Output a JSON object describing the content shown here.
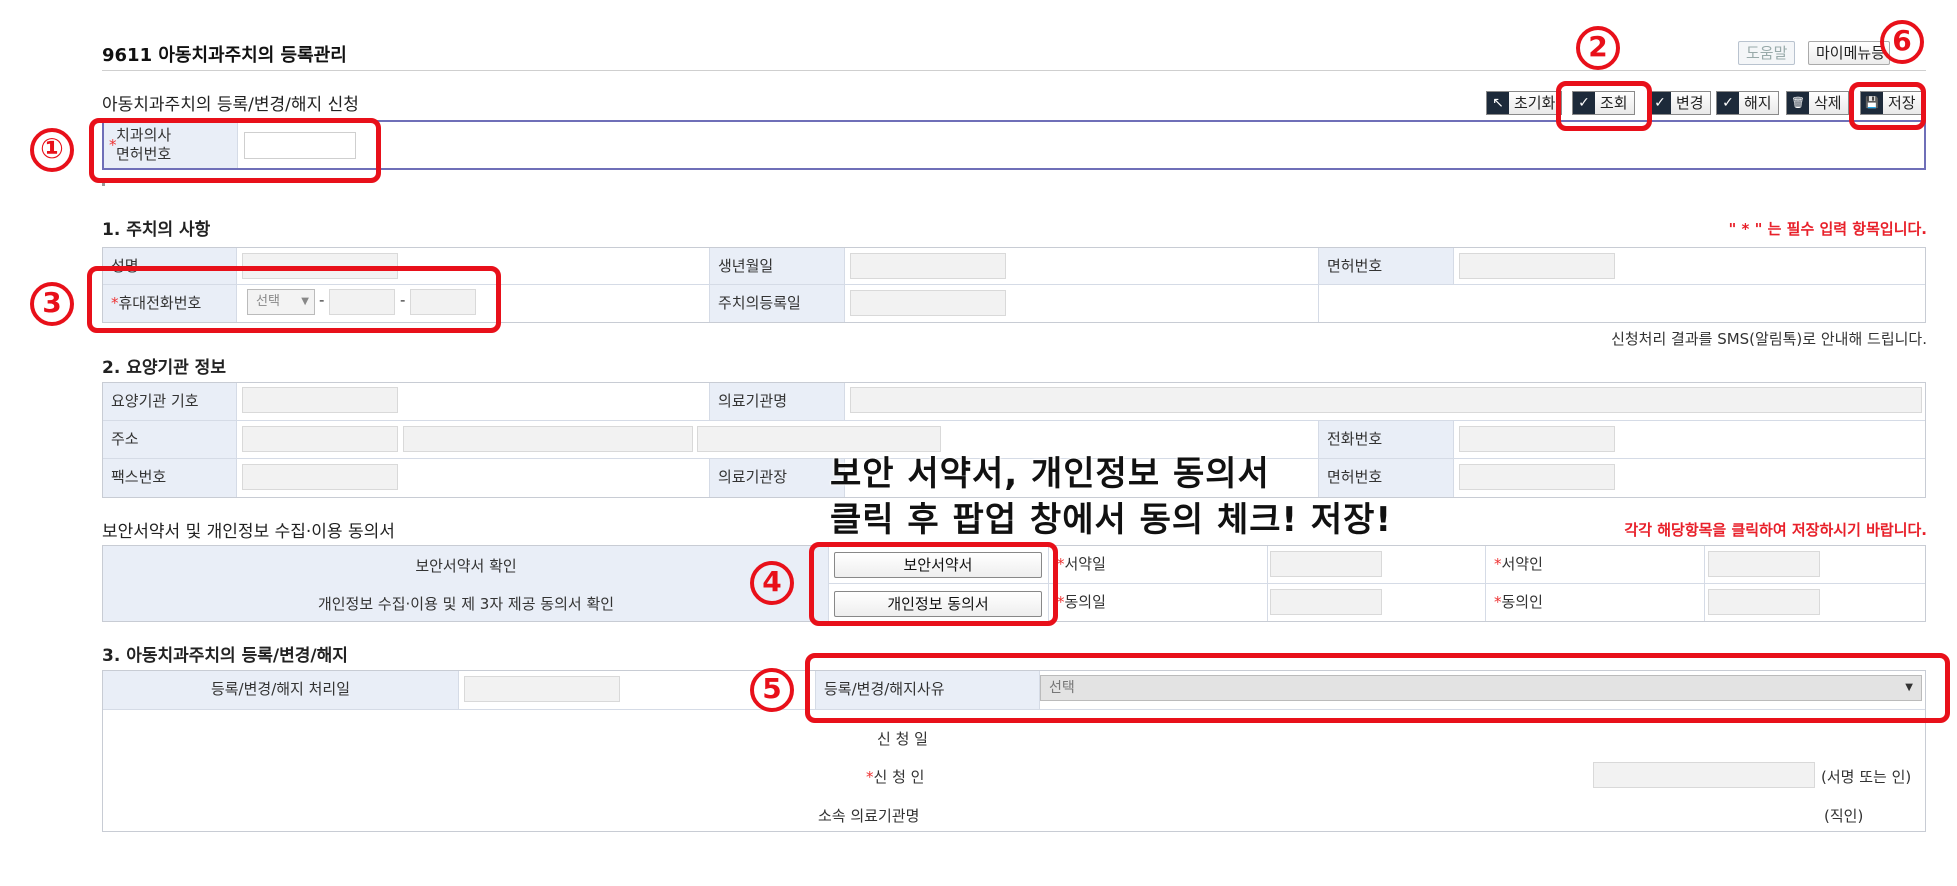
{
  "header": {
    "title": "9611 아동치과주치의 등록관리",
    "help_label": "도움말",
    "mymenu_label": "마이메뉴등",
    "section_title": "아동치과주치의 등록/변경/해지 신청"
  },
  "actions": [
    {
      "label": "초기화",
      "icon": "↖"
    },
    {
      "label": "조회",
      "icon": "✓"
    },
    {
      "label": "변경",
      "icon": "✓"
    },
    {
      "label": "해지",
      "icon": "✓"
    },
    {
      "label": "삭제",
      "icon": "🗑"
    },
    {
      "label": "저장",
      "icon": "💾"
    }
  ],
  "license": {
    "label_line1": "치과의사",
    "label_line2": "면허번호",
    "required": "*"
  },
  "annotations": {
    "n1": "①",
    "n2": "2",
    "n3": "3",
    "n4": "4",
    "n5": "5",
    "n6": "6",
    "overlay_line1": "보안 서약서, 개인정보 동의서",
    "overlay_line2": "클릭 후 팝업 창에서 동의 체크! 저장!"
  },
  "section1": {
    "title": "1. 주치의 사항",
    "required_note": "\" * \" 는 필수 입력 항목입니다.",
    "name_label": "성명",
    "birth_label": "생년월일",
    "license_label": "면허번호",
    "phone_label": "휴대전화번호",
    "phone_select": "선택",
    "dash": "-",
    "regdate_label": "주치의등록일",
    "sms_note": "신청처리 결과를 SMS(알림톡)로 안내해 드립니다."
  },
  "section2": {
    "title": "2. 요양기관 정보",
    "code_label": "요양기관 기호",
    "inst_name_label": "의료기관명",
    "address_label": "주소",
    "phone_label": "전화번호",
    "fax_label": "팩스번호",
    "head_label": "의료기관장",
    "license_label": "면허번호"
  },
  "consent": {
    "title": "보안서약서 및 개인정보 수집·이용 동의서",
    "note": "각각 해당항목을 클릭하여 저장하시기 바랍니다.",
    "row1_label": "보안서약서 확인",
    "row1_button": "보안서약서",
    "row1_date_label": "서약일",
    "row1_person_label": "서약인",
    "row2_label": "개인정보 수집·이용 및 제 3자 제공 동의서 확인",
    "row2_button": "개인정보 동의서",
    "row2_date_label": "동의일",
    "row2_person_label": "동의인"
  },
  "section3": {
    "title": "3. 아동치과주치의 등록/변경/해지",
    "process_date_label": "등록/변경/해지 처리일",
    "reason_label": "등록/변경/해지사유",
    "reason_select": "선택",
    "apply_date_label": "신 청 일",
    "applicant_label": "신 청 인",
    "sign_note": "(서명 또는 인)",
    "inst_label": "소속 의료기관명",
    "seal_note": "(직인)"
  }
}
